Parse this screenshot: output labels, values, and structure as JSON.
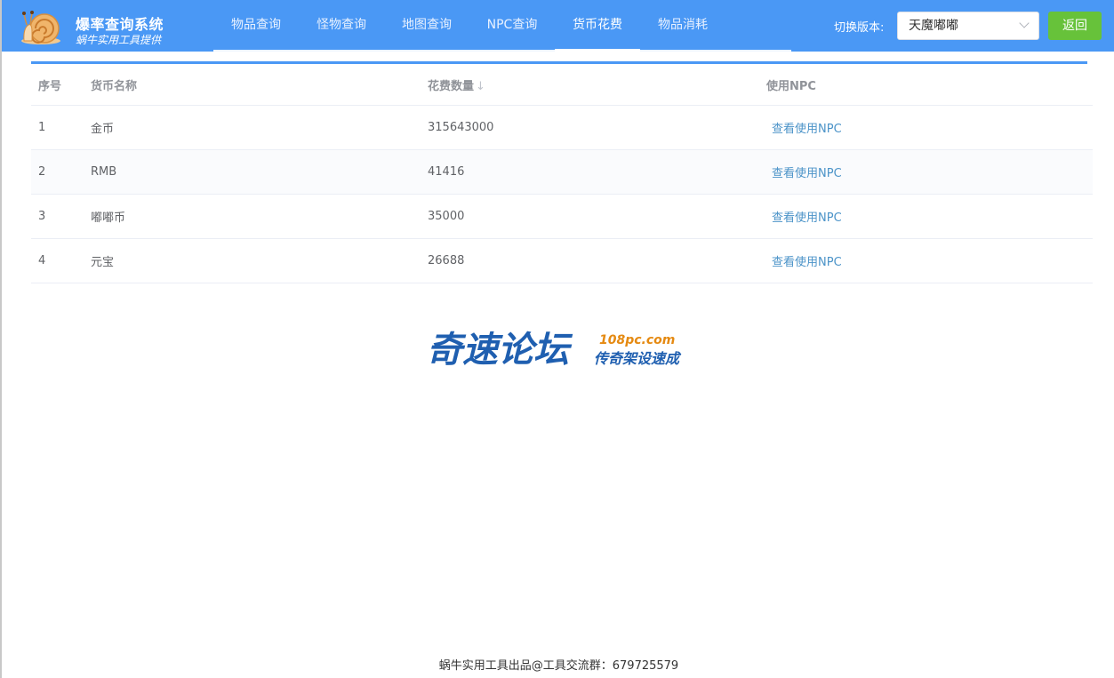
{
  "header": {
    "title": "爆率查询系统",
    "subtitle": "蜗牛实用工具提供",
    "nav": [
      {
        "label": "物品查询",
        "active": false
      },
      {
        "label": "怪物查询",
        "active": false
      },
      {
        "label": "地图查询",
        "active": false
      },
      {
        "label": "NPC查询",
        "active": false
      },
      {
        "label": "货币花费",
        "active": true
      },
      {
        "label": "物品消耗",
        "active": false
      }
    ],
    "version_label": "切换版本:",
    "version_value": "天魔嘟嘟",
    "back_label": "返回"
  },
  "table": {
    "columns": [
      "序号",
      "货币名称",
      "花费数量",
      "使用NPC"
    ],
    "sort_icon": "↓",
    "rows": [
      {
        "index": "1",
        "name": "金币",
        "amount": "315643000",
        "action": "查看使用NPC"
      },
      {
        "index": "2",
        "name": "RMB",
        "amount": "41416",
        "action": "查看使用NPC"
      },
      {
        "index": "3",
        "name": "嘟嘟币",
        "amount": "35000",
        "action": "查看使用NPC"
      },
      {
        "index": "4",
        "name": "元宝",
        "amount": "26688",
        "action": "查看使用NPC"
      }
    ]
  },
  "watermark": {
    "main": "奇速论坛",
    "domain": "108pc.com",
    "tagline": "传奇架设速成"
  },
  "footer": {
    "text": "蜗牛实用工具出品@工具交流群：679725579"
  },
  "colors": {
    "header_bg": "#4a98f5",
    "back_button": "#67c23a",
    "link": "#4b93c8"
  }
}
